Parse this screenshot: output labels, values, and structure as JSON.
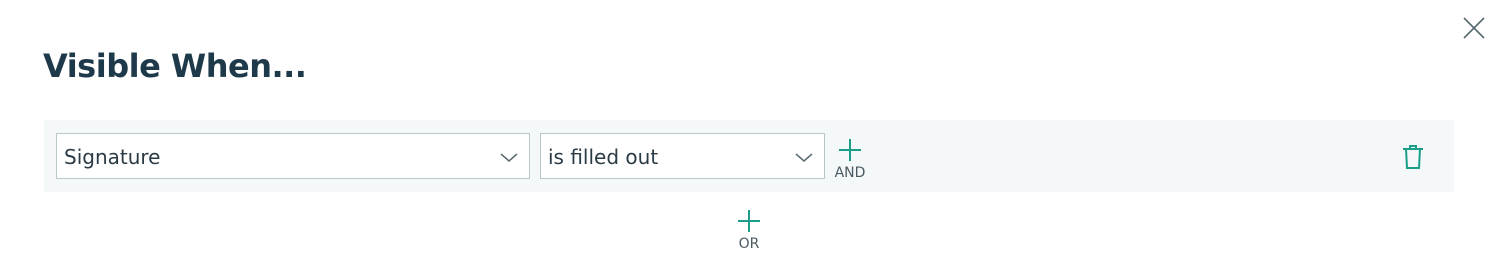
{
  "dialog": {
    "title": "Visible When...",
    "close_icon": "close-icon"
  },
  "rule": {
    "field": {
      "value": "Signature",
      "icon": "chevron-down-icon"
    },
    "condition": {
      "value": "is filled out",
      "icon": "chevron-down-icon"
    },
    "and_button": {
      "label": "AND",
      "icon": "plus-icon"
    },
    "delete_icon": "trash-icon"
  },
  "or_button": {
    "label": "OR",
    "icon": "plus-icon"
  },
  "colors": {
    "accent": "#1a9e8a",
    "title": "#1e3a4a",
    "row_background": "#f4f8f8",
    "border": "#b8c6c9"
  }
}
